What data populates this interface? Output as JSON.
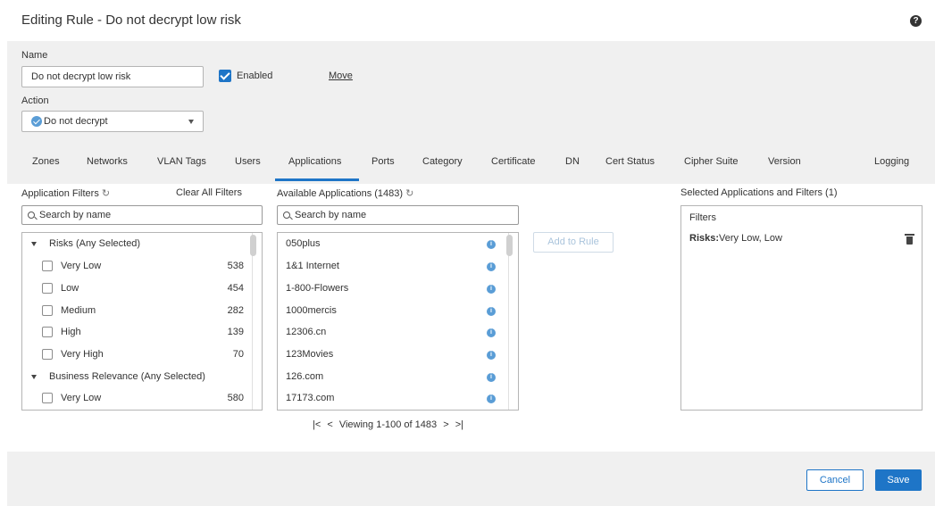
{
  "title": "Editing Rule - Do not decrypt low risk",
  "form": {
    "name_label": "Name",
    "name_value": "Do not decrypt low risk",
    "enabled_label": "Enabled",
    "move_label": "Move",
    "action_label": "Action",
    "action_value": "Do not decrypt"
  },
  "tabs": [
    "Zones",
    "Networks",
    "VLAN Tags",
    "Users",
    "Applications",
    "Ports",
    "Category",
    "Certificate",
    "DN",
    "Cert Status",
    "Cipher Suite",
    "Version",
    "Logging"
  ],
  "active_tab": "Applications",
  "filters": {
    "label": "Application Filters",
    "clear_all": "Clear All Filters",
    "search_placeholder": "Search by name",
    "groups": [
      {
        "title": "Risks (Any Selected)",
        "items": [
          {
            "label": "Very Low",
            "count": "538"
          },
          {
            "label": "Low",
            "count": "454"
          },
          {
            "label": "Medium",
            "count": "282"
          },
          {
            "label": "High",
            "count": "139"
          },
          {
            "label": "Very High",
            "count": "70"
          }
        ]
      },
      {
        "title": "Business Relevance (Any Selected)",
        "items": [
          {
            "label": "Very Low",
            "count": "580"
          }
        ]
      }
    ]
  },
  "available": {
    "label": "Available Applications (1483)",
    "search_placeholder": "Search by name",
    "items": [
      "050plus",
      "1&1 Internet",
      "1-800-Flowers",
      "1000mercis",
      "12306.cn",
      "123Movies",
      "126.com",
      "17173.com"
    ],
    "pager_text": "Viewing 1-100 of 1483"
  },
  "add_to_rule": "Add to Rule",
  "selected": {
    "label": "Selected Applications and Filters (1)",
    "filters_heading": "Filters",
    "entry_key": "Risks:",
    "entry_value": "Very Low, Low"
  },
  "buttons": {
    "cancel": "Cancel",
    "save": "Save"
  },
  "colors": {
    "accent": "#1e75c7",
    "info": "#5a9dd6",
    "panel_gray": "#f0f0f0"
  }
}
